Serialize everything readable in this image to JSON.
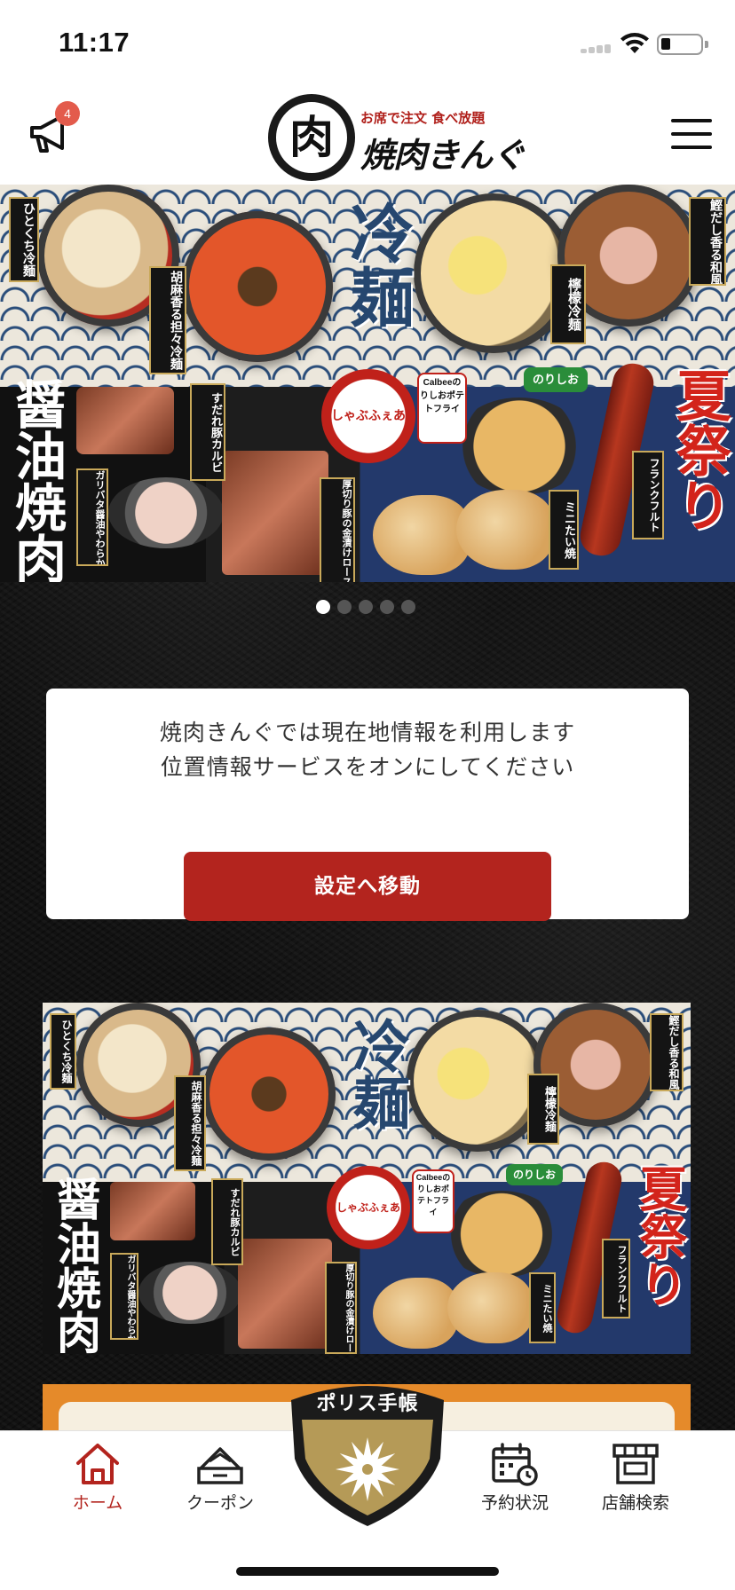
{
  "status_bar": {
    "time": "11:17"
  },
  "header": {
    "notification_count": "4",
    "logo": {
      "mark": "肉",
      "tagline": "お席で注文 食べ放題",
      "name": "焼肉きんぐ"
    }
  },
  "banner": {
    "title_reimen": "冷麺",
    "title_shoyu": "醤油焼肉",
    "title_natsu": "夏祭り",
    "shabu": "しゃぶふぇあ",
    "labels": [
      "ひとくち冷麺",
      "胡麻香る担々冷麺",
      "檸檬冷麺",
      "鰹だし香る和風冷麺",
      "すだれ豚カルビ",
      "ガリバタ醤油やわらかホルモン",
      "厚切り豚の金漬けロース",
      "Calbeeのりしおポテトフライ",
      "のりしお",
      "ミニたい焼",
      "フランクフルト"
    ]
  },
  "carousel": {
    "count": 5,
    "active": 0
  },
  "location_card": {
    "line1": "焼肉きんぐでは現在地情報を利用します",
    "line2": "位置情報サービスをオンにしてください",
    "button": "設定へ移動"
  },
  "tabs": [
    {
      "label": "ホーム",
      "icon": "home-icon",
      "active": true
    },
    {
      "label": "クーポン",
      "icon": "coupon-icon",
      "active": false
    },
    {
      "label": "予約状況",
      "icon": "calendar-clock-icon",
      "active": false
    },
    {
      "label": "店舗検索",
      "icon": "store-icon",
      "active": false
    }
  ],
  "police_notebook": {
    "label": "ポリス手帳"
  },
  "colors": {
    "accent_red": "#b3241e",
    "badge_red": "#e35b4c",
    "emblem_gold": "#b59a57"
  }
}
